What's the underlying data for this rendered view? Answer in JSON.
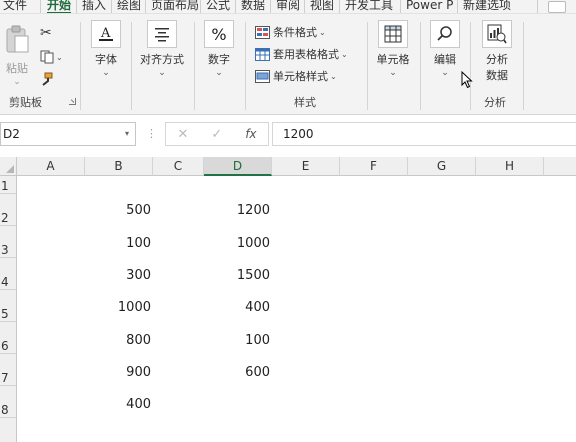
{
  "ribbon_tabs": [
    "文件",
    "开始",
    "插入",
    "绘图",
    "页面布局",
    "公式",
    "数据",
    "审阅",
    "视图",
    "开发工具",
    "Power P",
    "新建选项"
  ],
  "active_tab": "开始",
  "clipboard": {
    "paste_label": "粘贴",
    "group_label": "剪贴板"
  },
  "font_group": {
    "label": "字体"
  },
  "align_group": {
    "label": "对齐方式"
  },
  "number_group": {
    "label": "数字"
  },
  "styles": {
    "conditional": "条件格式",
    "table_format": "套用表格格式",
    "cell_styles": "单元格样式",
    "group_label": "样式"
  },
  "cells_group": {
    "label": "单元格"
  },
  "editing_group": {
    "label": "编辑"
  },
  "analysis": {
    "button_line1": "分析",
    "button_line2": "数据",
    "group_label": "分析"
  },
  "formula_bar": {
    "name_box": "D2",
    "fx": "fx",
    "value": "1200"
  },
  "columns": [
    "A",
    "B",
    "C",
    "D",
    "E",
    "F",
    "G",
    "H"
  ],
  "selected_column": "D",
  "rows": [
    "1",
    "2",
    "3",
    "4",
    "5",
    "6",
    "7",
    "8"
  ],
  "column_b": [
    "500",
    "100",
    "300",
    "1000",
    "800",
    "900",
    "400"
  ],
  "column_d": [
    "1200",
    "1000",
    "1500",
    "400",
    "100",
    "600"
  ],
  "colors": {
    "accent": "#217346",
    "ribbon_bg": "#f3f3f3",
    "header_bg": "#efefef"
  }
}
